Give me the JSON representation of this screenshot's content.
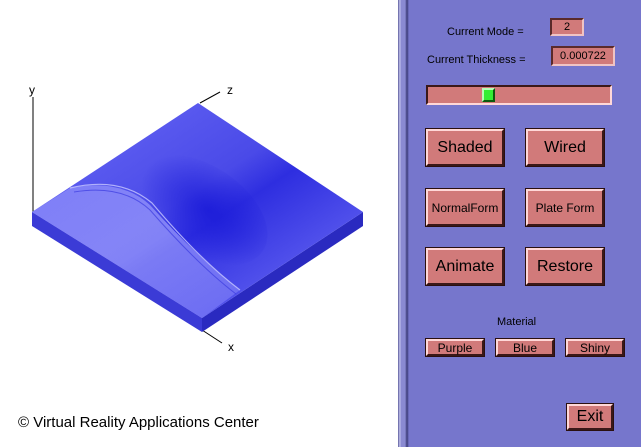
{
  "viewport": {
    "axes": {
      "x": "x",
      "y": "y",
      "z": "z"
    },
    "surface_color": "#5a5af0",
    "copyright": "© Virtual Reality Applications Center"
  },
  "panel": {
    "background": "#7676cc",
    "mode_label": "Current Mode =",
    "mode_value": "2",
    "thickness_label": "Current Thickness =",
    "thickness_value": "0.000722",
    "thickness_slider_fraction": 0.32,
    "buttons": {
      "shaded": "Shaded",
      "wired": "Wired",
      "normal_form": "NormalForm",
      "plate_form": "Plate Form",
      "animate": "Animate",
      "restore": "Restore"
    },
    "material_label": "Material",
    "material_buttons": {
      "purple": "Purple",
      "blue": "Blue",
      "shiny": "Shiny"
    },
    "exit": "Exit"
  }
}
